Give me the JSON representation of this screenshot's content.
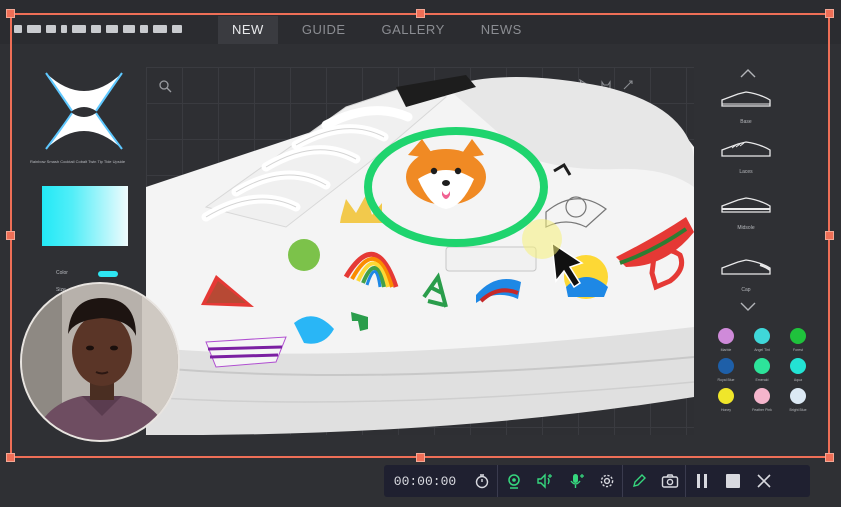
{
  "nav": {
    "tabs": [
      {
        "label": "NEW",
        "active": true
      },
      {
        "label": "GUIDE",
        "active": false
      },
      {
        "label": "GALLERY",
        "active": false
      },
      {
        "label": "NEWS",
        "active": false
      }
    ]
  },
  "left_panel": {
    "shape_names": "Rainbow  Smash  Cocktail  Cobalt  Twin Tip  Tide  Upside",
    "color_label": "Color",
    "color_value": "#2ee6f2",
    "size_label": "Size"
  },
  "right_panel": {
    "shoes": [
      {
        "label": "Base"
      },
      {
        "label": "Laces"
      },
      {
        "label": "Midsole"
      },
      {
        "label": "Cap"
      }
    ],
    "colors": [
      {
        "name": "Marble",
        "hex": "#cf8ad9"
      },
      {
        "name": "Angel Tint",
        "hex": "#3fd7d9"
      },
      {
        "name": "Forest",
        "hex": "#1fc23c"
      },
      {
        "name": "Royal Blue",
        "hex": "#1e5fa8"
      },
      {
        "name": "Emerald",
        "hex": "#2de39a"
      },
      {
        "name": "Aqua",
        "hex": "#23e3d4"
      },
      {
        "name": "Honey",
        "hex": "#f0e62a"
      },
      {
        "name": "Feather Pink",
        "hex": "#f5b5cc"
      },
      {
        "name": "Bright Blue",
        "hex": "#dce9f4"
      }
    ]
  },
  "recorder": {
    "timer": "00:00:00"
  },
  "accent_colors": {
    "selection": "#ef6f57",
    "highlight_ring": "#1fd46e"
  }
}
